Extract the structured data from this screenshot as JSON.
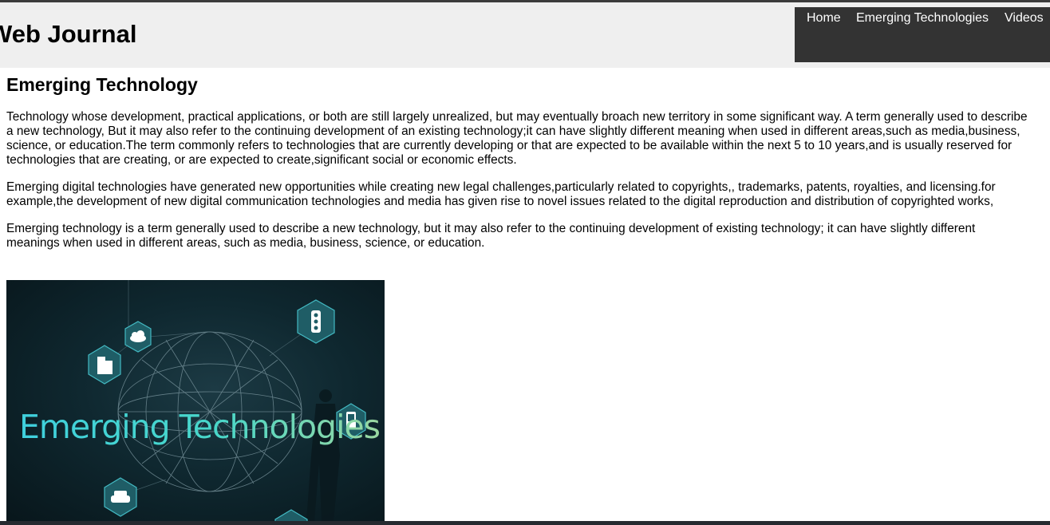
{
  "header": {
    "site_title": "Web Journal",
    "nav": [
      {
        "label": "Home"
      },
      {
        "label": "Emerging Technologies"
      },
      {
        "label": "Videos"
      }
    ]
  },
  "article": {
    "title": "Emerging Technology",
    "paragraphs": [
      "Technology whose development, practical applications, or both are still largely unrealized, but may eventually broach new territory in some significant way. A term generally used to describe a new technology, But it may also refer to the continuing development of an existing technology;it can have slightly different meaning when used in different areas,such as media,business, science, or education.The term commonly refers to technologies that are currently developing or that are expected to be available within the next 5 to 10 years,and is usually reserved for technologies that are creating, or are expected to create,significant social or economic effects.",
      "Emerging digital technologies have generated new opportunities while creating new legal challenges,particularly related to copyrights,, trademarks, patents, royalties, and licensing.for example,the development of new digital communication technologies and media has given rise to novel issues related to the digital reproduction and distribution of copyrighted works,",
      "Emerging technology is a term generally used to describe a new technology, but it may also refer to the continuing development of existing technology; it can have slightly different meanings when used in different areas, such as media, business, science, or education."
    ],
    "image": {
      "caption": "Emerging Technologies",
      "icons": [
        "cloud-icon",
        "building-icon",
        "traffic-light-icon",
        "mobile-phone-icon",
        "car-icon"
      ]
    }
  },
  "colors": {
    "header_bg": "#efefef",
    "nav_bg": "#333333",
    "nav_text": "#ffffff",
    "image_caption": "#3fd0dd"
  }
}
